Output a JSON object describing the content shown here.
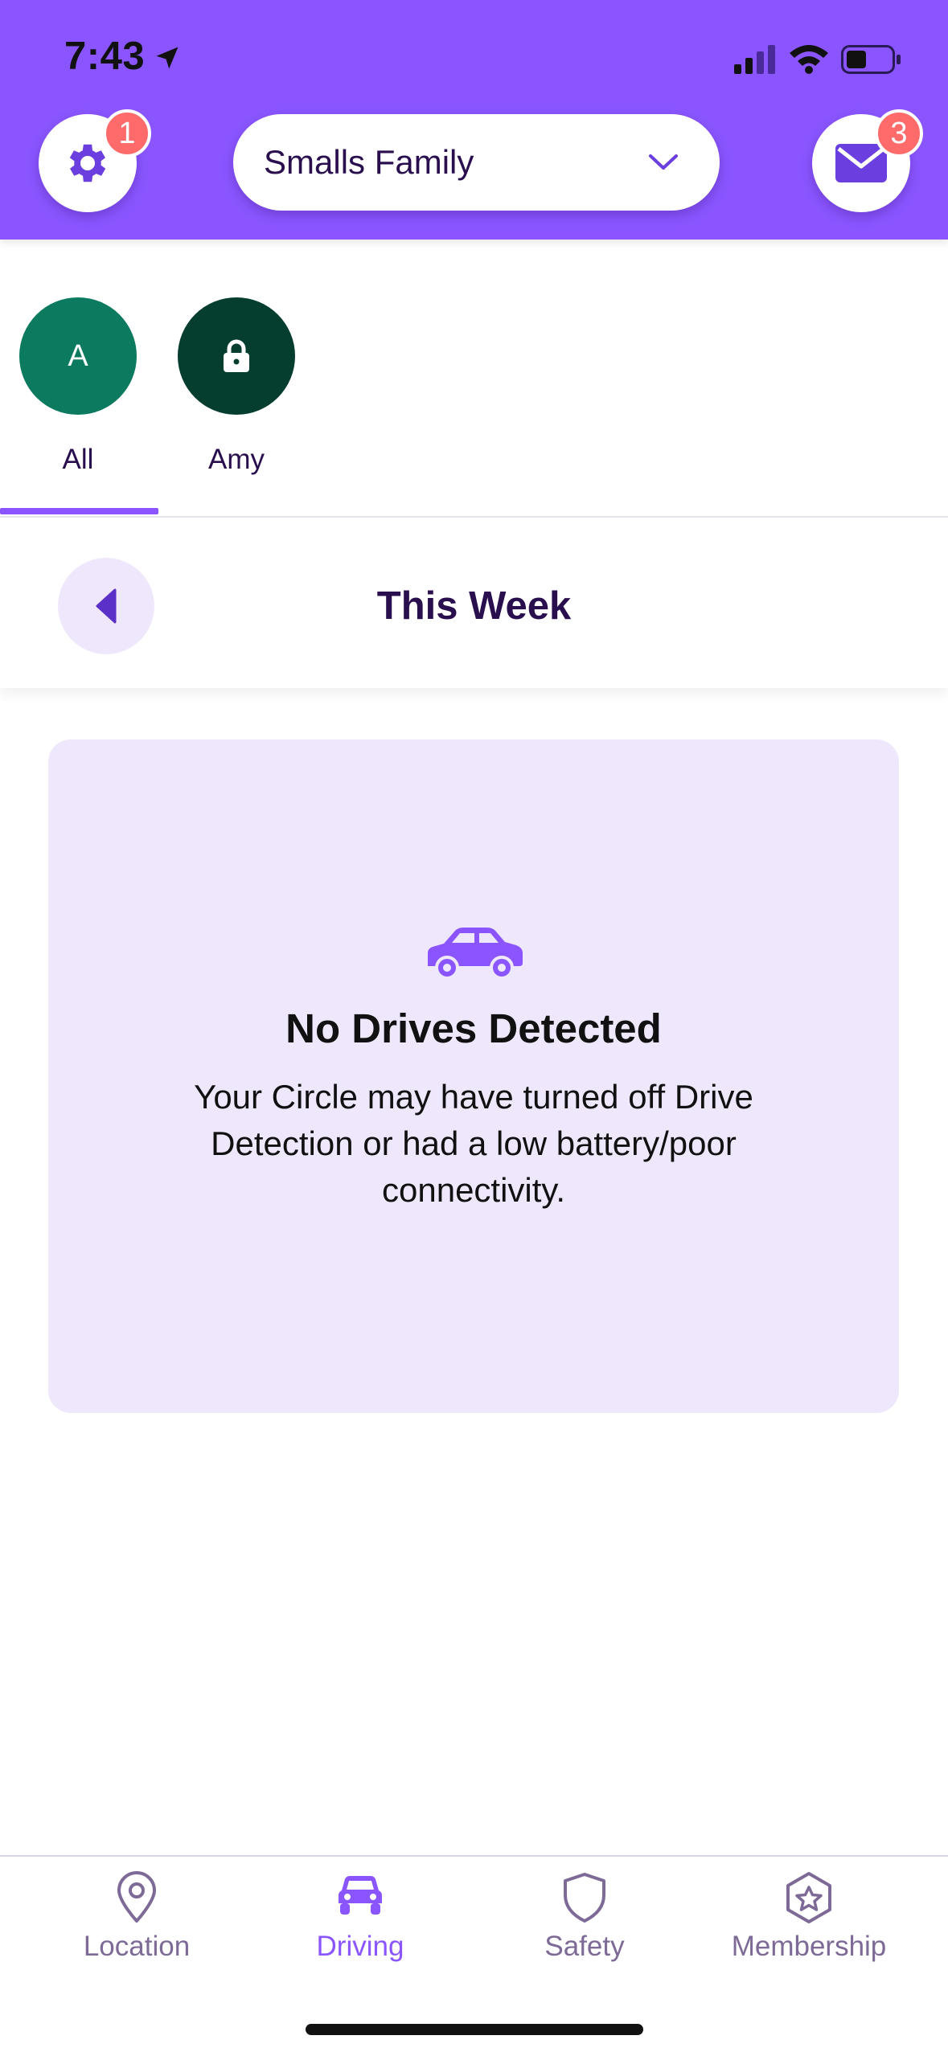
{
  "status_bar": {
    "time": "7:43"
  },
  "header": {
    "circle_name": "Smalls Family",
    "settings_badge": "1",
    "messages_badge": "3"
  },
  "members": [
    {
      "initial": "A",
      "name": "All",
      "selected": true
    },
    {
      "initial": "",
      "name": "Amy",
      "locked": true
    }
  ],
  "week": {
    "title": "This Week"
  },
  "empty_state": {
    "title": "No Drives Detected",
    "message": "Your Circle may have turned off Drive Detection or had a low battery/poor connectivity."
  },
  "nav": {
    "items": [
      {
        "label": "Location",
        "icon": "map-pin-icon"
      },
      {
        "label": "Driving",
        "icon": "car-icon",
        "active": true
      },
      {
        "label": "Safety",
        "icon": "shield-icon"
      },
      {
        "label": "Membership",
        "icon": "star-badge-icon"
      }
    ]
  },
  "colors": {
    "brand": "#8a55ff",
    "badge": "#ff6b6b",
    "avatar_all": "#0b7a5e",
    "avatar_amy": "#053d2f",
    "card_bg": "#efe8fd"
  }
}
